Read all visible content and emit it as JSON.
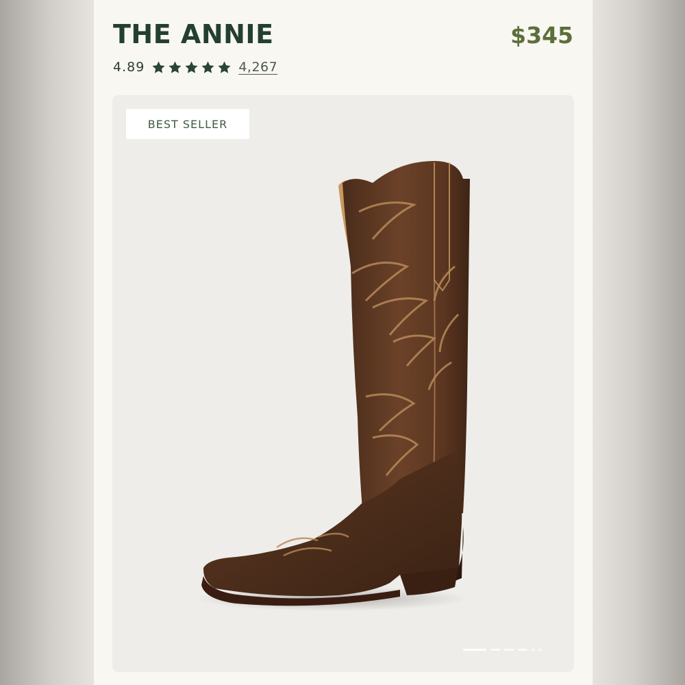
{
  "product": {
    "title": "THE ANNIE",
    "price": "$345",
    "rating": "4.89",
    "rating_stars": 5,
    "review_count": "4,267",
    "badge": "BEST SELLER"
  },
  "gallery": {
    "image": "brown-leather-cowboy-boot",
    "slide_count": 6,
    "active_slide": 1
  },
  "colors": {
    "title": "#243f2f",
    "price": "#5d6e3b",
    "star": "#2b4535",
    "card_bg": "#f9f7f2",
    "media_bg": "#efede9"
  }
}
